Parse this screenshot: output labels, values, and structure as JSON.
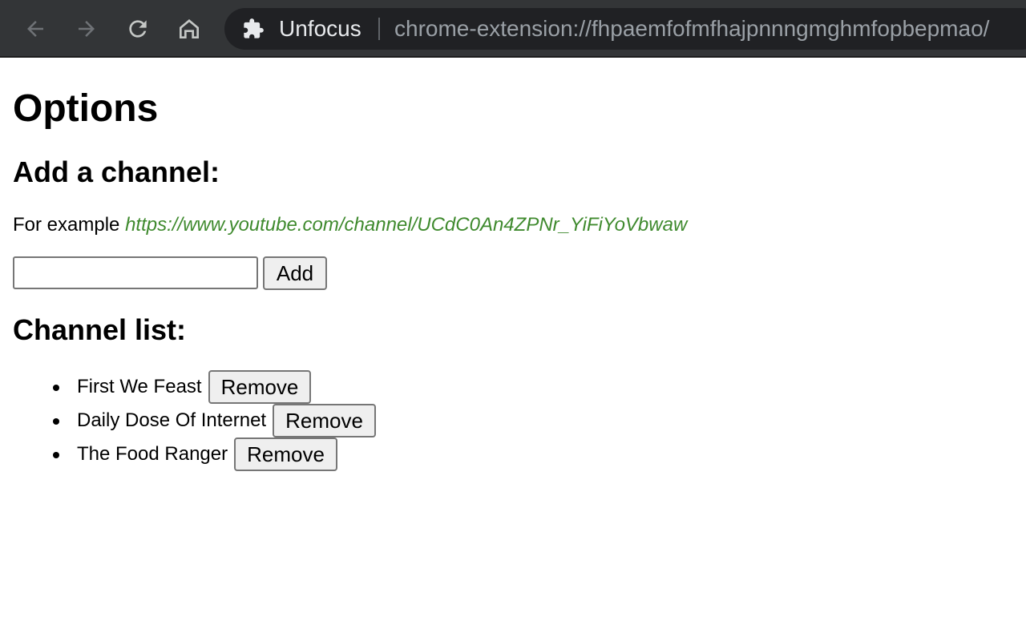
{
  "browser": {
    "back_icon": "arrow-left-icon",
    "forward_icon": "arrow-right-icon",
    "reload_icon": "reload-icon",
    "home_icon": "home-icon",
    "extension_icon": "puzzle-piece-icon",
    "extension_name": "Unfocus",
    "url": "chrome-extension://fhpaemfofmfhajpnnngmghmfopbepmao/"
  },
  "page": {
    "title": "Options",
    "add_heading": "Add a channel:",
    "example_prefix": "For example",
    "example_url": "https://www.youtube.com/channel/UCdC0An4ZPNr_YiFiYoVbwaw",
    "input_value": "",
    "add_label": "Add",
    "list_heading": "Channel list:",
    "channels": [
      {
        "name": "First We Feast",
        "remove_label": "Remove"
      },
      {
        "name": "Daily Dose Of Internet",
        "remove_label": "Remove"
      },
      {
        "name": "The Food Ranger",
        "remove_label": "Remove"
      }
    ]
  },
  "colors": {
    "toolbar": "#333537",
    "omnibox": "#202124",
    "link": "#3f8a2e"
  }
}
